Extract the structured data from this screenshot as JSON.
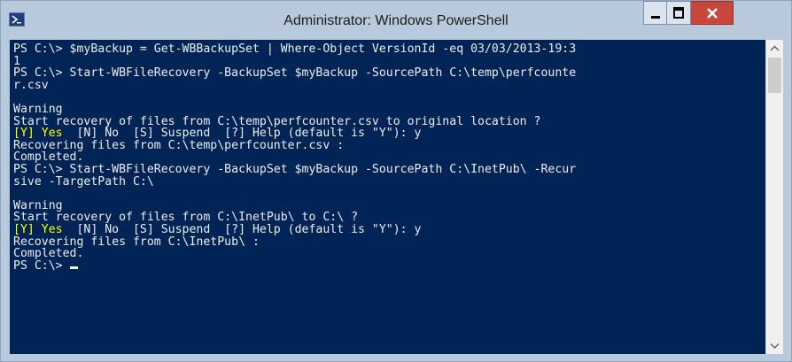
{
  "window": {
    "title": "Administrator: Windows PowerShell",
    "icon": "powershell-icon",
    "controls": [
      "minimize-icon",
      "maximize-icon",
      "close-icon"
    ]
  },
  "colors": {
    "console_background": "#012456",
    "console_text": "#eeedf0",
    "prompt_highlight": "#ffff00",
    "frame": "#b9c9dc",
    "close_button": "#c9463d"
  },
  "console": {
    "lines": [
      "PS C:\\> $myBackup = Get-WBBackupSet | Where-Object VersionId -eq 03/03/2013-19:3",
      "1",
      "PS C:\\> Start-WBFileRecovery -BackupSet $myBackup -SourcePath C:\\temp\\perfcounte",
      "r.csv",
      "",
      "Warning",
      "Start recovery of files from C:\\temp\\perfcounter.csv to original location ?",
      {
        "highlight": "[Y] Yes",
        "rest": "  [N] No  [S] Suspend  [?] Help (default is \"Y\"): y"
      },
      "Recovering files from C:\\temp\\perfcounter.csv :",
      "Completed.",
      "PS C:\\> Start-WBFileRecovery -BackupSet $myBackup -SourcePath C:\\InetPub\\ -Recur",
      "sive -TargetPath C:\\",
      "",
      "Warning",
      "Start recovery of files from C:\\InetPub\\ to C:\\ ?",
      {
        "highlight": "[Y] Yes",
        "rest": "  [N] No  [S] Suspend  [?] Help (default is \"Y\"): y"
      },
      "Recovering files from C:\\InetPub\\ :",
      "Completed.",
      {
        "prompt": "PS C:\\> ",
        "cursor": true
      }
    ]
  },
  "scrollbar": {
    "icons": [
      "scroll-up-arrow-icon",
      "scroll-down-arrow-icon"
    ]
  }
}
